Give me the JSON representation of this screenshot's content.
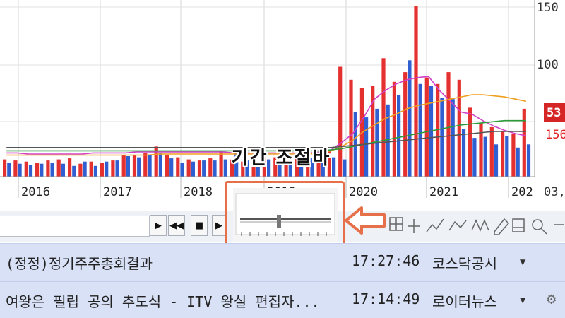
{
  "chart_data": {
    "type": "bar",
    "x_labels": [
      "2016",
      "2017",
      "2018",
      "2019",
      "2020",
      "2021",
      "202"
    ],
    "y_tick_labels": [
      "150",
      "100"
    ],
    "price_tag": "53",
    "price_tag_secondary": "156",
    "right_corner_label": "03,",
    "series": [
      {
        "color": "#e53030",
        "values": [
          16,
          15,
          14,
          13,
          15,
          16,
          17,
          12,
          14,
          13,
          15,
          20,
          20,
          22,
          28,
          20,
          18,
          16,
          15,
          17,
          24,
          16,
          14,
          17,
          18,
          18,
          15,
          19,
          16,
          16,
          24,
          102,
          90,
          82,
          84,
          110,
          88,
          97,
          158,
          92,
          86,
          97,
          90,
          64,
          50,
          46,
          42,
          40,
          63
        ]
      },
      {
        "color": "#2f5fd0",
        "values": [
          13,
          12,
          11,
          12,
          13,
          12,
          10,
          14,
          10,
          14,
          15,
          19,
          18,
          20,
          22,
          17,
          13,
          14,
          15,
          15,
          16,
          22,
          15,
          12,
          16,
          15,
          16,
          14,
          17,
          15,
          18,
          16,
          60,
          55,
          63,
          67,
          76,
          108,
          86,
          84,
          73,
          72,
          44,
          36,
          37,
          30,
          38,
          27,
          30
        ]
      }
    ],
    "moving_averages": [
      {
        "color": "#d040c8",
        "values": [
          22,
          22,
          21,
          21,
          21,
          21,
          21,
          21,
          22,
          22,
          22,
          22,
          23,
          23,
          23,
          23,
          23,
          23,
          23,
          23,
          23,
          22,
          22,
          22,
          22,
          22,
          22,
          22,
          22,
          23,
          25,
          32,
          40,
          55,
          72,
          80,
          86,
          90,
          92,
          93,
          80,
          70,
          60,
          58,
          52,
          47,
          43,
          40,
          38
        ]
      },
      {
        "color": "#f0a020",
        "values": [
          20,
          20,
          20,
          20,
          20,
          20,
          20,
          20,
          20,
          20,
          20,
          20,
          20,
          20,
          21,
          21,
          21,
          21,
          21,
          21,
          21,
          21,
          21,
          21,
          21,
          21,
          21,
          21,
          21,
          22,
          24,
          28,
          34,
          42,
          48,
          54,
          58,
          63,
          66,
          68,
          70,
          72,
          74,
          76,
          76,
          75,
          74,
          72,
          70
        ]
      },
      {
        "color": "#2a9a3a",
        "values": [
          24,
          24,
          24,
          24,
          24,
          24,
          24,
          24,
          24,
          24,
          24,
          24,
          24,
          24,
          24,
          24,
          24,
          24,
          24,
          24,
          24,
          24,
          24,
          24,
          24,
          24,
          24,
          24,
          24,
          24,
          25,
          26,
          28,
          30,
          32,
          34,
          36,
          38,
          40,
          42,
          44,
          46,
          48,
          49,
          50,
          51,
          52,
          52,
          52
        ]
      },
      {
        "color": "#555555",
        "values": [
          27,
          27,
          27,
          27,
          27,
          27,
          27,
          27,
          27,
          27,
          27,
          27,
          27,
          27,
          27,
          27,
          27,
          27,
          27,
          27,
          27,
          27,
          27,
          27,
          27,
          27,
          27,
          27,
          27,
          27,
          27,
          28,
          29,
          30,
          31,
          32,
          33,
          34,
          35,
          36,
          37,
          38,
          39,
          40,
          41,
          42,
          42,
          42,
          42
        ]
      }
    ]
  },
  "annotation": {
    "label": "기간 조절바"
  },
  "toolbar": {
    "play_icon": "play-icon",
    "rewind_icon": "rewind-icon",
    "stop_icon": "stop-icon",
    "forward_icon": "forward-icon",
    "search_icon": "magnifier-icon"
  },
  "news": [
    {
      "title": "(정정)정기주주총회결과",
      "time": "17:27:46",
      "source": "코스닥공시"
    },
    {
      "title": "여왕은 필립 공의 추도식 - ITV 왕실 편집자...",
      "time": "17:14:49",
      "source": "로이터뉴스"
    }
  ],
  "colors": {
    "up": "#e53030",
    "down": "#2f5fd0",
    "news_bg": "#d9e1f7",
    "highlight": "#e5704a"
  }
}
